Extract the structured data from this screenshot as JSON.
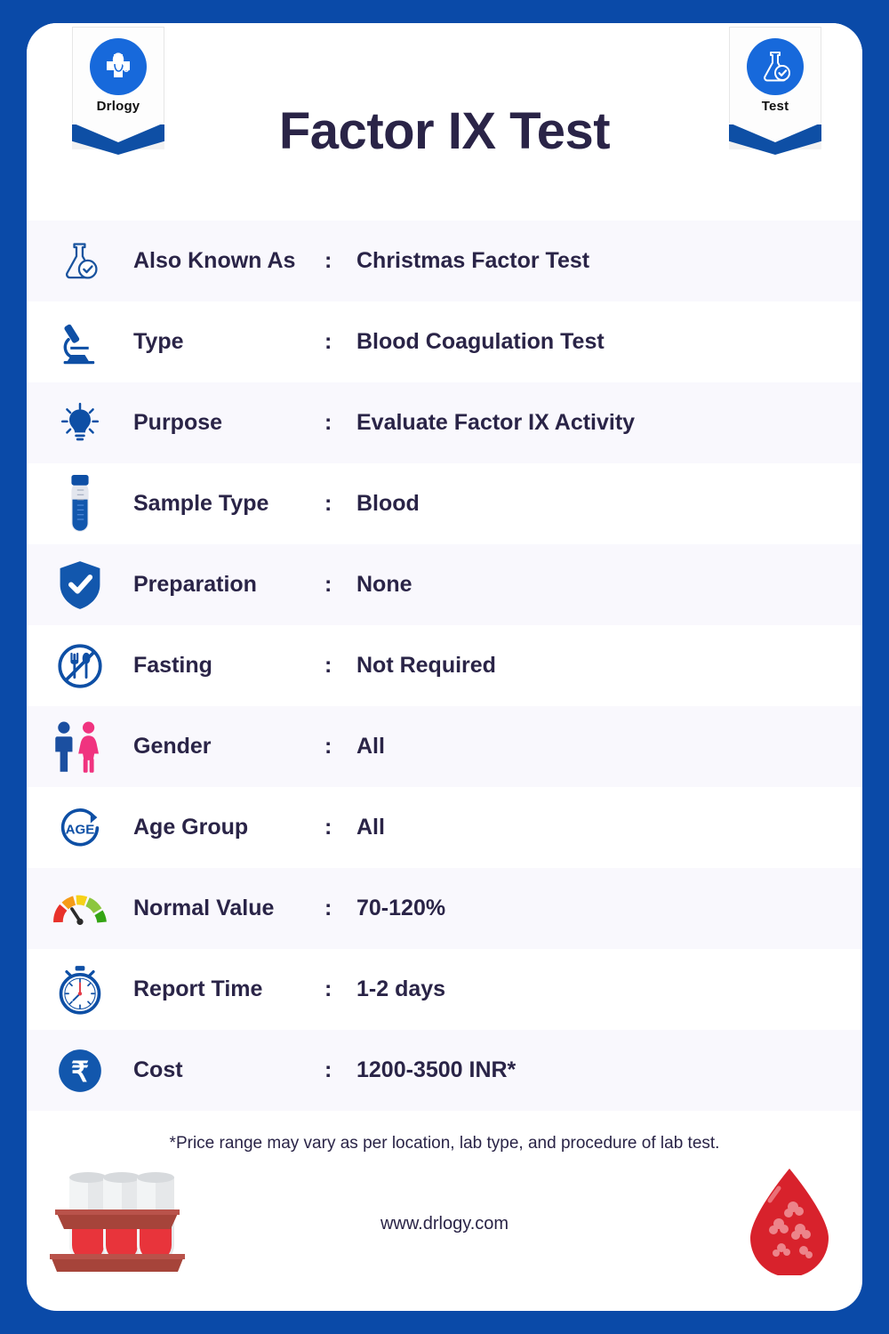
{
  "header": {
    "title": "Factor IX Test",
    "left_badge": {
      "label": "Drlogy",
      "icon": "medical-cross-stethoscope-icon"
    },
    "right_badge": {
      "label": "Test",
      "icon": "flask-check-icon"
    }
  },
  "colors": {
    "border_blue": "#0a4aa8",
    "icon_blue": "#0e4fa5",
    "text_navy": "#2a2447",
    "row_tint": "#f9f8fd",
    "male_blue": "#1b4fa0",
    "female_pink": "#f0337f",
    "blood_red": "#d8222c"
  },
  "rows": [
    {
      "icon": "flask-check-icon",
      "label": "Also Known As",
      "colon": ":",
      "value": "Christmas Factor Test"
    },
    {
      "icon": "microscope-icon",
      "label": "Type",
      "colon": ":",
      "value": "Blood Coagulation Test"
    },
    {
      "icon": "lightbulb-icon",
      "label": "Purpose",
      "colon": ":",
      "value": "Evaluate Factor IX Activity"
    },
    {
      "icon": "test-tube-icon",
      "label": "Sample Type",
      "colon": ":",
      "value": "Blood"
    },
    {
      "icon": "shield-check-icon",
      "label": "Preparation",
      "colon": ":",
      "value": "None"
    },
    {
      "icon": "no-food-fasting-icon",
      "label": "Fasting",
      "colon": ":",
      "value": "Not Required"
    },
    {
      "icon": "male-female-gender-icon",
      "label": "Gender",
      "colon": ":",
      "value": "All"
    },
    {
      "icon": "age-group-icon",
      "label": "Age Group",
      "colon": ":",
      "value": "All"
    },
    {
      "icon": "gauge-meter-icon",
      "label": "Normal Value",
      "colon": ":",
      "value": "70-120%"
    },
    {
      "icon": "stopwatch-icon",
      "label": "Report Time",
      "colon": ":",
      "value": "1-2 days"
    },
    {
      "icon": "rupee-coin-icon",
      "label": "Cost",
      "colon": ":",
      "value": "1200-3500 INR*"
    }
  ],
  "footer": {
    "disclaimer": "*Price range may vary as per location, lab type, and procedure of lab test.",
    "website": "www.drlogy.com",
    "left_illustration": "test-tube-rack-icon",
    "right_illustration": "blood-drop-icon"
  }
}
